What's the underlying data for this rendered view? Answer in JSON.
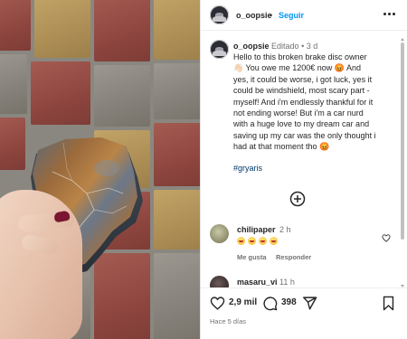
{
  "post": {
    "author": "o_oopsie",
    "separator": "•",
    "follow_label": "Seguir",
    "caption_author": "o_oopsie",
    "edited_label": "Editado",
    "caption_age": "3 d",
    "caption_lines": [
      "Hello to this broken brake disc owner",
      "👋🏻 You owe me 1200€ now 😡 And",
      "yes, it could be worse, i got luck, yes it",
      "could be windshield, most scary part -",
      "myself! And i'm endlessly thankful for it",
      "not ending worse! But i'm a car nurd",
      "with a huge love to my dream car and",
      "saving up my car was the only thought i",
      "had at that moment tho 😡"
    ],
    "hashtag": "#gryaris",
    "likes": "2,9 mil",
    "comments_count": "398",
    "posted_ago": "Hace 5 días"
  },
  "comments": [
    {
      "user": "chilipaper",
      "time": "2 h",
      "emojis": [
        "laugh",
        "laugh",
        "laugh",
        "laugh"
      ],
      "likes_label": "Me gusta",
      "reply_label": "Responder"
    },
    {
      "user": "masaru_vi",
      "time": "11 h"
    }
  ],
  "icons": {
    "more": "more-horizontal-icon",
    "add_comment": "plus-circle-icon",
    "like": "heart-icon",
    "comment": "comment-bubble-icon",
    "share": "send-icon",
    "save": "bookmark-icon"
  },
  "colors": {
    "follow": "#0095f6",
    "hashtag": "#00376b",
    "muted": "#737373",
    "text": "#262626"
  }
}
